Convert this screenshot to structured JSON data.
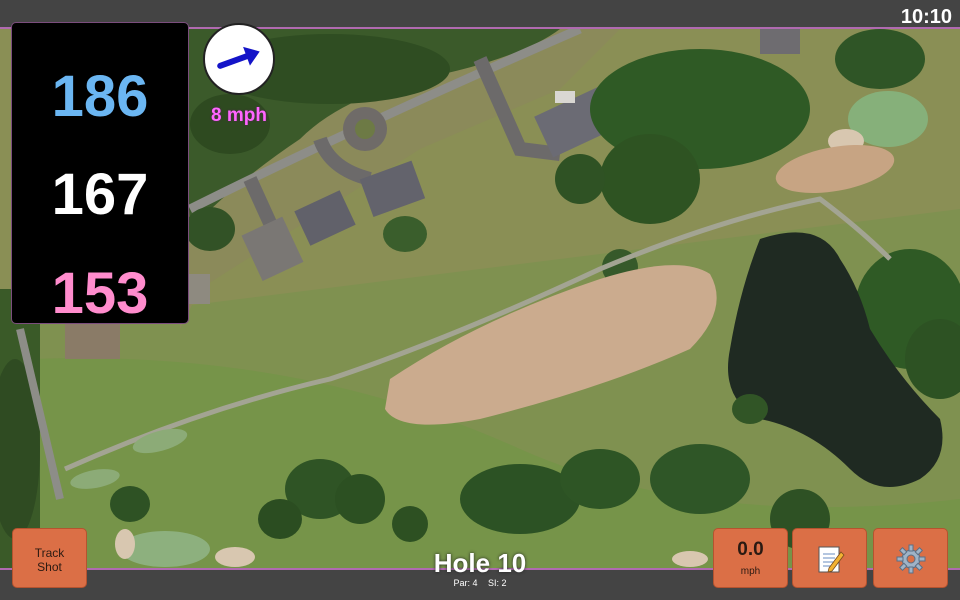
{
  "status_bar": {
    "time": "10:10"
  },
  "distances": {
    "back": "186",
    "center": "167",
    "front": "153"
  },
  "wind": {
    "speed_label": "8 mph",
    "icon": "wind-arrow-icon",
    "direction_deg": -20
  },
  "hole": {
    "title": "Hole 10",
    "par": "Par: 4",
    "stroke_index": "SI: 2"
  },
  "buttons": {
    "track_shot": {
      "line1": "Track",
      "line2": "Shot"
    },
    "speed": {
      "value": "0.0",
      "unit": "mph"
    },
    "notes": {
      "icon": "notepad-icon"
    },
    "settings": {
      "icon": "gear-icon"
    }
  },
  "colors": {
    "back_distance": "#6bb6f2",
    "center_distance": "#ffffff",
    "front_distance": "#ff8ccd",
    "wind_text": "#ff66ff",
    "button_orange": "#db6f46",
    "accent_border": "#b06ab0"
  }
}
